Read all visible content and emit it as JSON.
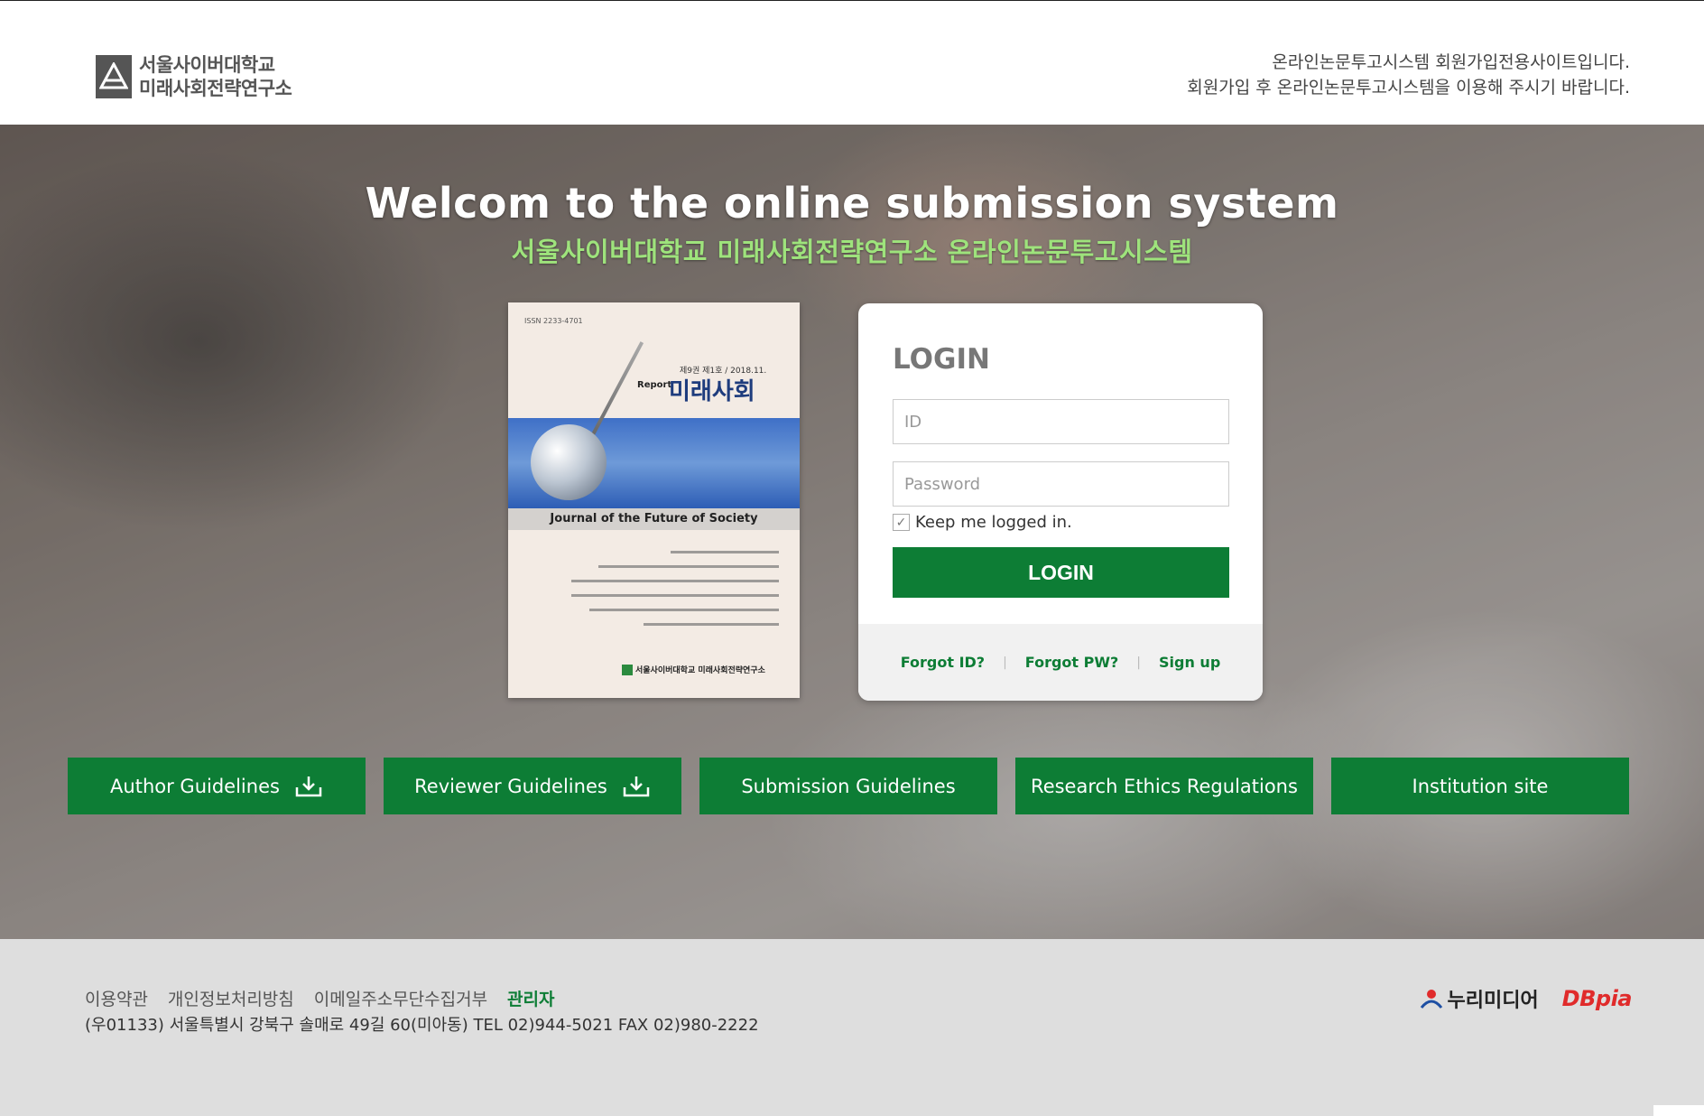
{
  "header": {
    "logo_line1": "서울사이버대학교",
    "logo_line2": "미래사회전략연구소",
    "notice_line1": "온라인논문투고시스템 회원가입전용사이트입니다.",
    "notice_line2": "회원가입 후 온라인논문투고시스템을 이용해 주시기 바랍니다."
  },
  "hero": {
    "title": "Welcom to the online submission system",
    "subtitle": "서울사이버대학교 미래사회전략연구소 온라인논문투고시스템"
  },
  "cover": {
    "issn": "ISSN 2233-4701",
    "volume": "제9권 제1호 / 2018.11.",
    "report": "Report",
    "title": "미래사회",
    "journal": "Journal of the Future of Society",
    "publisher": "서울사이버대학교 미래사회전략연구소"
  },
  "login": {
    "heading": "LOGIN",
    "id_placeholder": "ID",
    "pw_placeholder": "Password",
    "keep_label": "Keep me logged in.",
    "button_label": "LOGIN",
    "forgot_id": "Forgot ID?",
    "forgot_pw": "Forgot PW?",
    "signup": "Sign up"
  },
  "nav": [
    {
      "label": "Author Guidelines",
      "icon": "download-icon"
    },
    {
      "label": "Reviewer Guidelines",
      "icon": "download-icon"
    },
    {
      "label": "Submission Guidelines"
    },
    {
      "label": "Research Ethics Regulations"
    },
    {
      "label": "Institution site"
    }
  ],
  "footer": {
    "links": [
      "이용약관",
      "개인정보처리방침",
      "이메일주소무단수집거부",
      "관리자"
    ],
    "address": "(우01133) 서울특별시 강북구 솔매로 49길 60(미아동) TEL 02)944-5021 FAX 02)980-2222",
    "partner1": "누리미디어",
    "partner2": "DBpia"
  },
  "colors": {
    "accent": "#0d7d35",
    "subtitle": "#9ee37c"
  }
}
